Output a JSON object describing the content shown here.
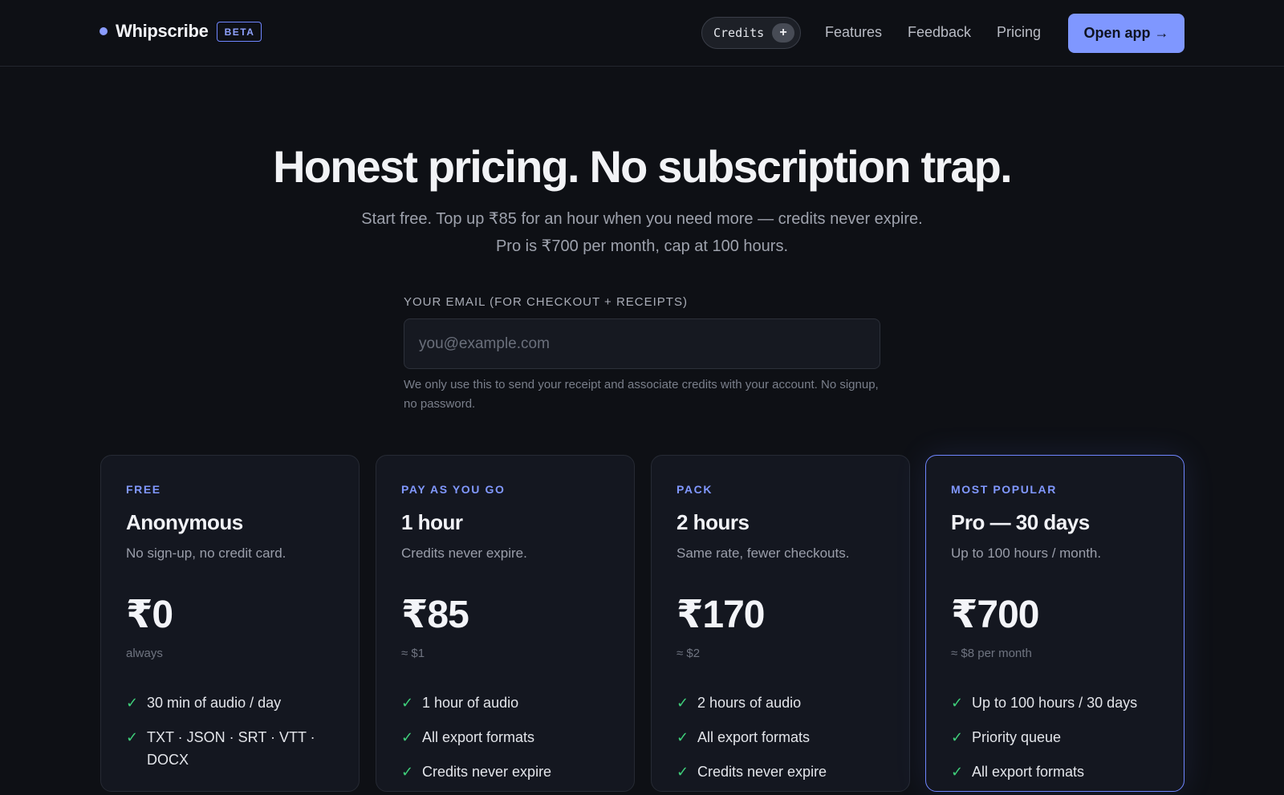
{
  "nav": {
    "brand": "Whipscribe",
    "badge": "BETA",
    "credits_label": "Credits",
    "credits_plus": "+",
    "links": [
      "Features",
      "Feedback",
      "Pricing"
    ],
    "cta": "Open app →"
  },
  "hero": {
    "title": "Honest pricing. No subscription trap.",
    "subtitle_line1": "Start free. Top up ₹85 for an hour when you need more — credits never expire.",
    "subtitle_line2": "Pro is ₹700 per month, cap at 100 hours."
  },
  "email": {
    "label": "YOUR EMAIL (FOR CHECKOUT + RECEIPTS)",
    "placeholder": "you@example.com",
    "value": "",
    "help": "We only use this to send your receipt and associate credits with your account. No signup, no password."
  },
  "plans": [
    {
      "tag": "FREE",
      "title": "Anonymous",
      "desc": "No sign-up, no credit card.",
      "price": "₹0",
      "note": "always",
      "features": [
        "30 min of audio / day",
        "TXT · JSON · SRT · VTT · DOCX"
      ]
    },
    {
      "tag": "PAY AS YOU GO",
      "title": "1 hour",
      "desc": "Credits never expire.",
      "price": "₹85",
      "note": "≈ $1",
      "features": [
        "1 hour of audio",
        "All export formats",
        "Credits never expire"
      ]
    },
    {
      "tag": "PACK",
      "title": "2 hours",
      "desc": "Same rate, fewer checkouts.",
      "price": "₹170",
      "note": "≈ $2",
      "features": [
        "2 hours of audio",
        "All export formats",
        "Credits never expire"
      ]
    },
    {
      "tag": "MOST POPULAR",
      "title": "Pro — 30 days",
      "desc": "Up to 100 hours / month.",
      "price": "₹700",
      "note": "≈ $8 per month",
      "features": [
        "Up to 100 hours / 30 days",
        "Priority queue",
        "All export formats"
      ]
    }
  ],
  "colors": {
    "accent": "#7f97ff",
    "check": "#3fcf7a",
    "background": "#0e1015",
    "card": "#141720"
  }
}
